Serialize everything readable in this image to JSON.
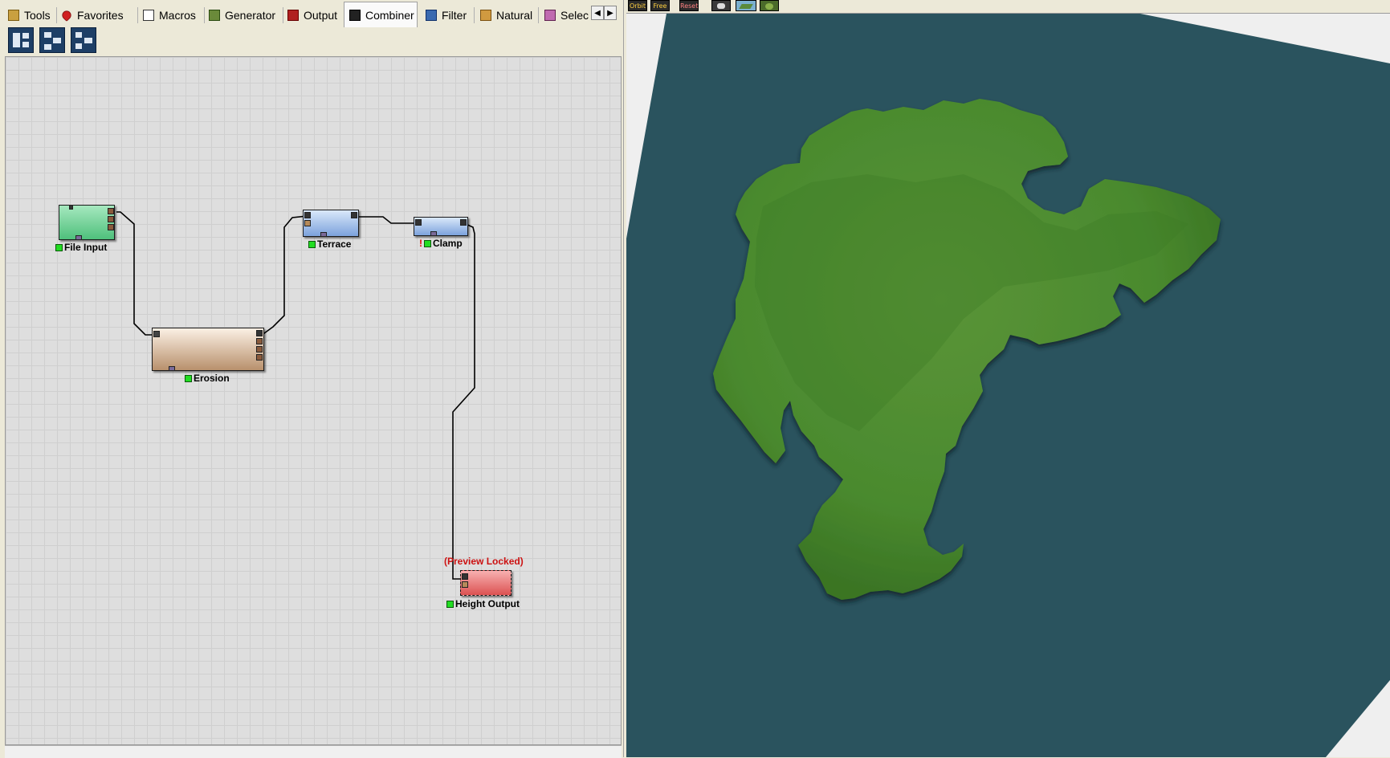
{
  "tabs": [
    {
      "label": "Tools",
      "icon": "tools-icon",
      "active": false
    },
    {
      "label": "Favorites",
      "icon": "heart-icon",
      "active": false
    },
    {
      "label": "Macros",
      "icon": "macro-icon",
      "active": false
    },
    {
      "label": "Generator",
      "icon": "generator-icon",
      "active": false
    },
    {
      "label": "Output",
      "icon": "output-icon",
      "active": false
    },
    {
      "label": "Combiner",
      "icon": "combiner-icon",
      "active": true
    },
    {
      "label": "Filter",
      "icon": "filter-icon",
      "active": false
    },
    {
      "label": "Natural",
      "icon": "natural-icon",
      "active": false
    },
    {
      "label": "Selec",
      "icon": "selector-icon",
      "active": false
    }
  ],
  "toolbar": {
    "buttons": [
      "layout-tree-icon",
      "layout-branch-icon",
      "layout-flow-icon"
    ]
  },
  "nodes": {
    "file_input": {
      "label": "File Input",
      "color": "#5fc98a"
    },
    "erosion": {
      "label": "Erosion",
      "color": "#c9a68a"
    },
    "terrace": {
      "label": "Terrace",
      "color": "#8fb3e4"
    },
    "clamp": {
      "label": "Clamp",
      "color": "#8fb3e4",
      "warning": "!"
    },
    "height_output": {
      "label": "Height Output",
      "color": "#e36b6b",
      "status": "(Preview Locked)"
    }
  },
  "view_toolbar": {
    "buttons": [
      {
        "label": "Orbit",
        "icon": "orbit-icon"
      },
      {
        "label": "Free",
        "icon": "free-camera-icon"
      },
      {
        "label": "Reset",
        "icon": "reset-view-icon"
      },
      {
        "label": "",
        "icon": "camera-icon"
      },
      {
        "label": "",
        "icon": "terrain-shade-icon"
      },
      {
        "label": "",
        "icon": "texture-icon"
      }
    ]
  },
  "colors": {
    "water": "#2a535e",
    "land": "#4a8a2e",
    "canvas": "#dedede"
  }
}
